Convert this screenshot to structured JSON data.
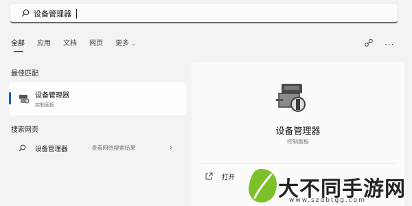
{
  "search": {
    "value": "设备管理器"
  },
  "tabs": [
    {
      "label": "全部"
    },
    {
      "label": "应用"
    },
    {
      "label": "文档"
    },
    {
      "label": "网页"
    },
    {
      "label": "更多"
    }
  ],
  "best_match": {
    "title": "最佳匹配",
    "name": "设备管理器",
    "subtitle": "控制面板"
  },
  "web_search": {
    "title": "搜索网页",
    "query": "设备管理器",
    "hint": "- 查看网络搜索结果"
  },
  "details": {
    "name": "设备管理器",
    "subtitle": "控制面板",
    "open_label": "打开"
  },
  "watermark": {
    "text": "大不同手游网",
    "url": "www.szdbtgg.com"
  },
  "colors": {
    "accent": "#1a5fb4",
    "watermark_green": "#7cc12a"
  }
}
